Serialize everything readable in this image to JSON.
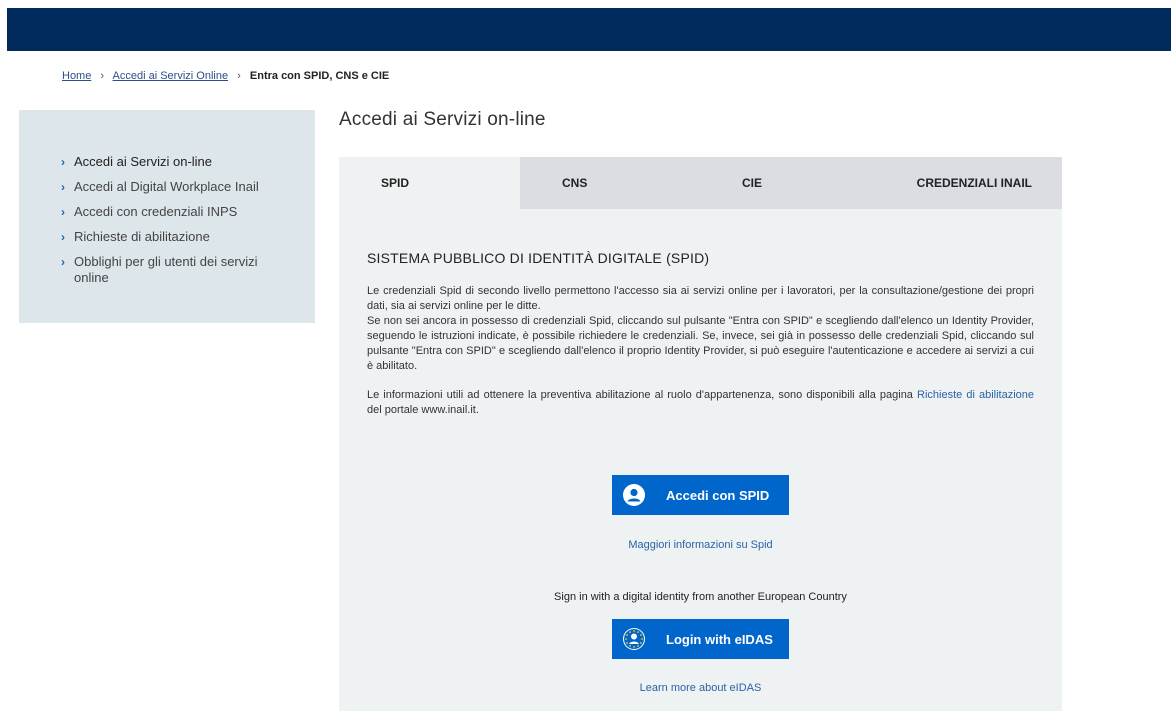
{
  "header": {
    "color": "#002b5c"
  },
  "breadcrumb": {
    "items": [
      "Home",
      "Accedi ai Servizi Online"
    ],
    "separator": "›",
    "current": "Entra con SPID, CNS e CIE"
  },
  "sidebar": {
    "items": [
      {
        "label": "Accedi ai Servizi on-line"
      },
      {
        "label": "Accedi al Digital Workplace Inail"
      },
      {
        "label": "Accedi con credenziali INPS"
      },
      {
        "label": "Richieste di abilitazione"
      },
      {
        "label": "Obblighi per gli utenti dei servizi online"
      }
    ],
    "chevron": "›"
  },
  "main": {
    "title": "Accedi ai Servizi on-line",
    "tabs": [
      {
        "label": "SPID"
      },
      {
        "label": "CNS"
      },
      {
        "label": "CIE"
      },
      {
        "label": "CREDENZIALI INAIL"
      }
    ],
    "section_title": "SISTEMA PUBBLICO DI IDENTITÀ DIGITALE (SPID)",
    "paragraph1": "Le credenziali Spid di secondo livello permettono l'accesso sia ai servizi online per i lavoratori, per la consultazione/gestione dei propri dati, sia ai servizi online per le ditte.",
    "paragraph2": "Se non sei ancora in possesso di credenziali Spid, cliccando sul pulsante \"Entra con SPID\" e scegliendo dall'elenco un Identity Provider, seguendo le istruzioni indicate, è possibile richiedere le credenziali. Se, invece, sei già in possesso delle credenziali Spid, cliccando sul pulsante \"Entra con SPID\" e scegliendo dall'elenco il proprio Identity Provider, si può eseguire l'autenticazione e accedere ai servizi a cui è abilitato.",
    "paragraph3_before": "Le informazioni utili ad ottenere la preventiva abilitazione al ruolo d'appartenenza, sono disponibili alla pagina ",
    "paragraph3_link": "Richieste di abilitazione",
    "paragraph3_after": " del portale www.inail.it.",
    "spid_button": "Accedi con SPID",
    "spid_info_link": "Maggiori informazioni su Spid",
    "eu_text": "Sign in with a digital identity from another European Country",
    "eidas_button": "Login with eIDAS",
    "eidas_info_link": "Learn more about eIDAS"
  },
  "colors": {
    "accent": "#0066cc",
    "panel": "#eef2f2",
    "sidebar": "#dde6ea"
  },
  "icons": {
    "spid": "user-circle-icon",
    "eidas": "eu-stars-icon"
  }
}
